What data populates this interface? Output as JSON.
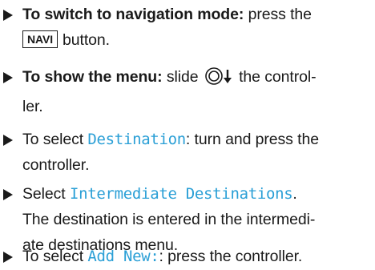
{
  "steps": [
    {
      "bold_lead": "To switch to navigation mode:",
      "text_1": "press the",
      "key_label": "NAVI",
      "text_2": "button."
    },
    {
      "bold_lead": "To show the menu:",
      "text_1": "slide",
      "icon": "controller-slide-down-icon",
      "text_2": "the control-",
      "text_3": "ler."
    },
    {
      "text_1": "To select",
      "display_term": "Destination",
      "text_2": ": turn and press the",
      "text_3": "controller."
    },
    {
      "text_1": "Select",
      "display_term": "Intermediate Destinations",
      "text_2": ".",
      "text_3": "The destination is entered in the intermedi-",
      "text_4": "ate destinations menu."
    },
    {
      "text_1": "To select",
      "display_term": "Add New:",
      "text_2": ": press the controller."
    }
  ],
  "colors": {
    "display_text": "#2a9fd6",
    "body_text": "#1a1a1a"
  }
}
